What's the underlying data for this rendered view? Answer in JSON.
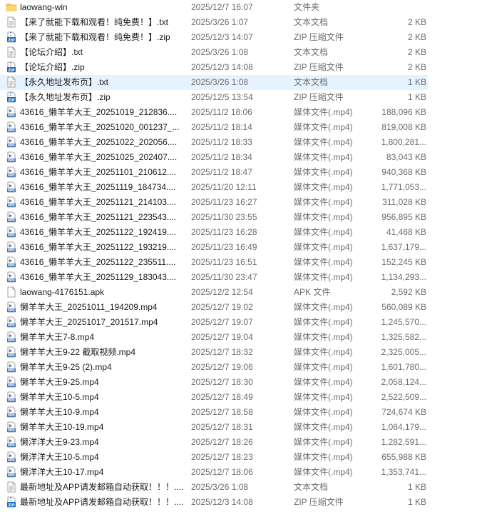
{
  "files": [
    {
      "icon": "folder-icon",
      "name": "laowang-win",
      "date": "2025/12/7 16:07",
      "type": "文件夹",
      "size": ""
    },
    {
      "icon": "text-file-icon",
      "name": "【来了就能下载和观看！纯免费！】.txt",
      "date": "2025/3/26 1:07",
      "type": "文本文档",
      "size": "2 KB"
    },
    {
      "icon": "zip-file-icon",
      "name": "【来了就能下载和观看！纯免费！】.zip",
      "date": "2025/12/3 14:07",
      "type": "ZIP 压缩文件",
      "size": "2 KB"
    },
    {
      "icon": "text-file-icon",
      "name": "【论坛介绍】.txt",
      "date": "2025/3/26 1:08",
      "type": "文本文档",
      "size": "2 KB"
    },
    {
      "icon": "zip-file-icon",
      "name": "【论坛介绍】.zip",
      "date": "2025/12/3 14:08",
      "type": "ZIP 压缩文件",
      "size": "2 KB"
    },
    {
      "icon": "text-file-icon",
      "name": "【永久地址发布页】.txt",
      "date": "2025/3/26 1:08",
      "type": "文本文档",
      "size": "1 KB",
      "selected": true
    },
    {
      "icon": "zip-file-icon",
      "name": "【永久地址发布页】.zip",
      "date": "2025/12/5 13:54",
      "type": "ZIP 压缩文件",
      "size": "1 KB"
    },
    {
      "icon": "mp4-file-icon",
      "name": "43616_懒羊羊大王_20251019_212836....",
      "date": "2025/11/2 18:06",
      "type": "媒体文件(.mp4)",
      "size": "188,096 KB"
    },
    {
      "icon": "mp4-file-icon",
      "name": "43616_懒羊羊大王_20251020_001237_...",
      "date": "2025/11/2 18:14",
      "type": "媒体文件(.mp4)",
      "size": "819,008 KB"
    },
    {
      "icon": "mp4-file-icon",
      "name": "43616_懒羊羊大王_20251022_202056....",
      "date": "2025/11/2 18:33",
      "type": "媒体文件(.mp4)",
      "size": "1,800,281..."
    },
    {
      "icon": "mp4-file-icon",
      "name": "43616_懒羊羊大王_20251025_202407....",
      "date": "2025/11/2 18:34",
      "type": "媒体文件(.mp4)",
      "size": "83,043 KB"
    },
    {
      "icon": "mp4-file-icon",
      "name": "43616_懒羊羊大王_20251101_210612....",
      "date": "2025/11/2 18:47",
      "type": "媒体文件(.mp4)",
      "size": "940,368 KB"
    },
    {
      "icon": "mp4-file-icon",
      "name": "43616_懒羊羊大王_20251119_184734....",
      "date": "2025/11/20 12:11",
      "type": "媒体文件(.mp4)",
      "size": "1,771,053..."
    },
    {
      "icon": "mp4-file-icon",
      "name": "43616_懒羊羊大王_20251121_214103....",
      "date": "2025/11/23 16:27",
      "type": "媒体文件(.mp4)",
      "size": "311,028 KB"
    },
    {
      "icon": "mp4-file-icon",
      "name": "43616_懒羊羊大王_20251121_223543....",
      "date": "2025/11/30 23:55",
      "type": "媒体文件(.mp4)",
      "size": "956,895 KB"
    },
    {
      "icon": "mp4-file-icon",
      "name": "43616_懒羊羊大王_20251122_192419....",
      "date": "2025/11/23 16:28",
      "type": "媒体文件(.mp4)",
      "size": "41,468 KB"
    },
    {
      "icon": "mp4-file-icon",
      "name": "43616_懒羊羊大王_20251122_193219....",
      "date": "2025/11/23 16:49",
      "type": "媒体文件(.mp4)",
      "size": "1,637,179..."
    },
    {
      "icon": "mp4-file-icon",
      "name": "43616_懒羊羊大王_20251122_235511....",
      "date": "2025/11/23 16:51",
      "type": "媒体文件(.mp4)",
      "size": "152,245 KB"
    },
    {
      "icon": "mp4-file-icon",
      "name": "43616_懒羊羊大王_20251129_183043....",
      "date": "2025/11/30 23:47",
      "type": "媒体文件(.mp4)",
      "size": "1,134,293..."
    },
    {
      "icon": "apk-file-icon",
      "name": "laowang-4176151.apk",
      "date": "2025/12/2 12:54",
      "type": "APK 文件",
      "size": "2,592 KB"
    },
    {
      "icon": "mp4-file-icon",
      "name": "懒羊羊大王_20251011_194209.mp4",
      "date": "2025/12/7 19:02",
      "type": "媒体文件(.mp4)",
      "size": "560,089 KB"
    },
    {
      "icon": "mp4-file-icon",
      "name": "懒羊羊大王_20251017_201517.mp4",
      "date": "2025/12/7 19:07",
      "type": "媒体文件(.mp4)",
      "size": "1,245,570..."
    },
    {
      "icon": "mp4-file-icon",
      "name": "懒羊羊大王7-8.mp4",
      "date": "2025/12/7 19:04",
      "type": "媒体文件(.mp4)",
      "size": "1,325,582..."
    },
    {
      "icon": "mp4-file-icon",
      "name": "懒羊羊大王9-22 截取视频.mp4",
      "date": "2025/12/7 18:32",
      "type": "媒体文件(.mp4)",
      "size": "2,325,005..."
    },
    {
      "icon": "mp4-file-icon",
      "name": "懒羊羊大王9-25 (2).mp4",
      "date": "2025/12/7 19:06",
      "type": "媒体文件(.mp4)",
      "size": "1,601,780..."
    },
    {
      "icon": "mp4-file-icon",
      "name": "懒羊羊大王9-25.mp4",
      "date": "2025/12/7 18:30",
      "type": "媒体文件(.mp4)",
      "size": "2,058,124..."
    },
    {
      "icon": "mp4-file-icon",
      "name": "懒羊羊大王10-5.mp4",
      "date": "2025/12/7 18:49",
      "type": "媒体文件(.mp4)",
      "size": "2,522,509..."
    },
    {
      "icon": "mp4-file-icon",
      "name": "懒羊羊大王10-9.mp4",
      "date": "2025/12/7 18:58",
      "type": "媒体文件(.mp4)",
      "size": "724,674 KB"
    },
    {
      "icon": "mp4-file-icon",
      "name": "懒羊羊大王10-19.mp4",
      "date": "2025/12/7 18:31",
      "type": "媒体文件(.mp4)",
      "size": "1,084,179..."
    },
    {
      "icon": "mp4-file-icon",
      "name": "懒洋洋大王9-23.mp4",
      "date": "2025/12/7 18:26",
      "type": "媒体文件(.mp4)",
      "size": "1,282,591..."
    },
    {
      "icon": "mp4-file-icon",
      "name": "懒洋洋大王10-5.mp4",
      "date": "2025/12/7 18:23",
      "type": "媒体文件(.mp4)",
      "size": "655,988 KB"
    },
    {
      "icon": "mp4-file-icon",
      "name": "懒洋洋大王10-17.mp4",
      "date": "2025/12/7 18:06",
      "type": "媒体文件(.mp4)",
      "size": "1,353,741..."
    },
    {
      "icon": "text-file-icon",
      "name": "最新地址及APP请发邮箱自动获取！！！....",
      "date": "2025/3/26 1:08",
      "type": "文本文档",
      "size": "1 KB"
    },
    {
      "icon": "zip-file-icon",
      "name": "最新地址及APP请发邮箱自动获取！！！....",
      "date": "2025/12/3 14:08",
      "type": "ZIP 压缩文件",
      "size": "1 KB"
    }
  ],
  "colors": {
    "selection": "#e5f3ff",
    "folder": "#f3c24f",
    "zip_blue": "#1f6fc0",
    "mp4_blue": "#3b73b9",
    "secondary_text": "#6d6d6d"
  }
}
